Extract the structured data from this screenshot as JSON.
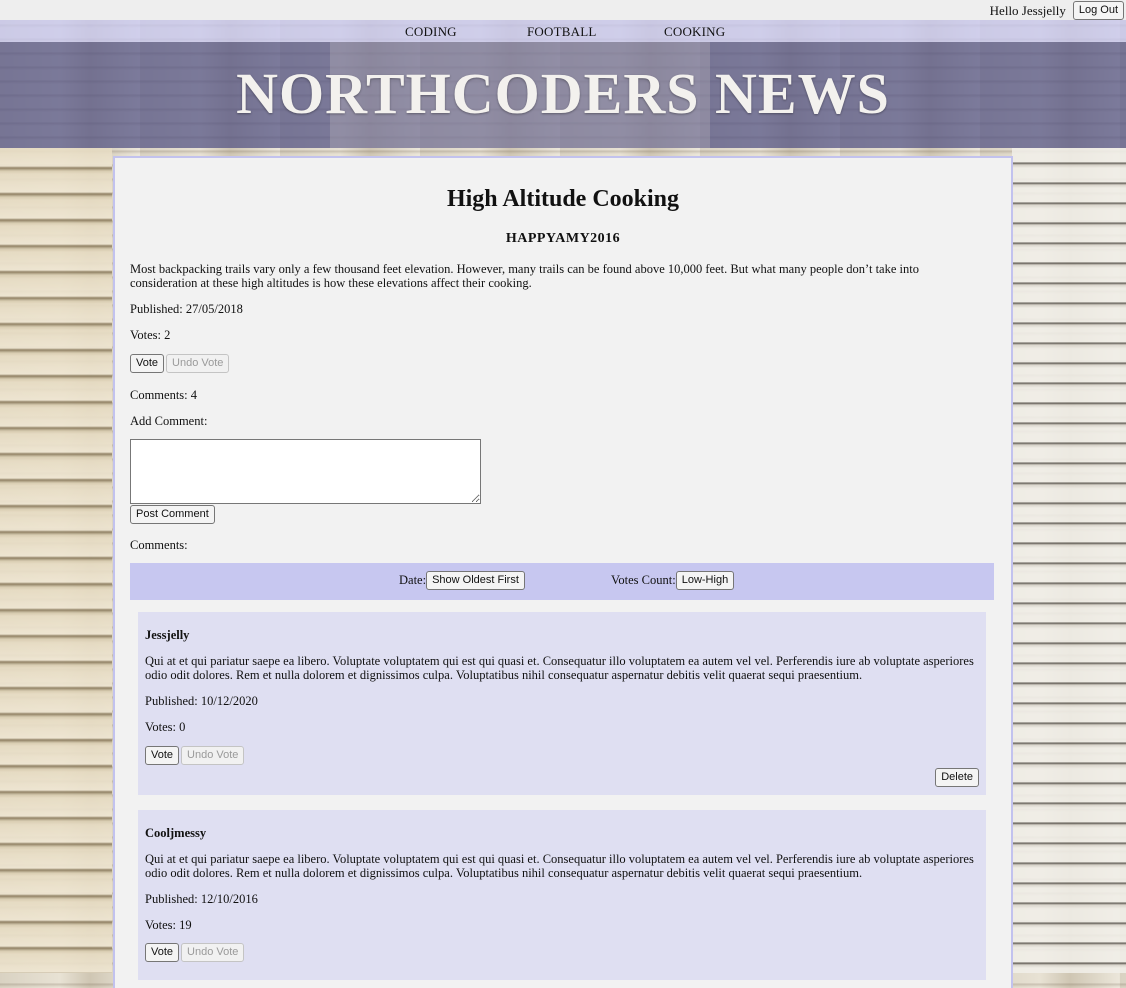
{
  "header": {
    "greeting": "Hello Jessjelly",
    "logout_label": "Log Out",
    "nav": [
      "CODING",
      "FOOTBALL",
      "COOKING"
    ],
    "site_title": "NORTHCODERS NEWS"
  },
  "article": {
    "title": "High Altitude Cooking",
    "author": "HAPPYAMY2016",
    "body": "Most backpacking trails vary only a few thousand feet elevation. However, many trails can be found above 10,000 feet. But what many people don’t take into consideration at these high altitudes is how these elevations affect their cooking.",
    "published": "Published: 27/05/2018",
    "votes": "Votes: 2",
    "vote_label": "Vote",
    "undo_vote_label": "Undo Vote",
    "comments_count": "Comments: 4",
    "add_comment_label": "Add Comment:",
    "comment_input_value": "",
    "post_comment_label": "Post Comment",
    "comments_heading": "Comments:"
  },
  "sort": {
    "date_label": "Date:",
    "date_button": "Show Oldest First",
    "votes_label": "Votes Count:",
    "votes_button": "Low-High"
  },
  "comments": [
    {
      "author": "Jessjelly",
      "body": "Qui at et qui pariatur saepe ea libero. Voluptate voluptatem qui est qui quasi et. Consequatur illo voluptatem ea autem vel vel. Perferendis iure ab voluptate asperiores odio odit dolores. Rem et nulla dolorem et dignissimos culpa. Voluptatibus nihil consequatur aspernatur debitis velit quaerat sequi praesentium.",
      "published": "Published: 10/12/2020",
      "votes": "Votes: 0",
      "vote_label": "Vote",
      "undo_vote_label": "Undo Vote",
      "delete_label": "Delete"
    },
    {
      "author": "Cooljmessy",
      "body": "Qui at et qui pariatur saepe ea libero. Voluptate voluptatem qui est qui quasi et. Consequatur illo voluptatem ea autem vel vel. Perferendis iure ab voluptate asperiores odio odit dolores. Rem et nulla dolorem et dignissimos culpa. Voluptatibus nihil consequatur aspernatur debitis velit quaerat sequi praesentium.",
      "published": "Published: 12/10/2016",
      "votes": "Votes: 19",
      "vote_label": "Vote",
      "undo_vote_label": "Undo Vote"
    }
  ]
}
